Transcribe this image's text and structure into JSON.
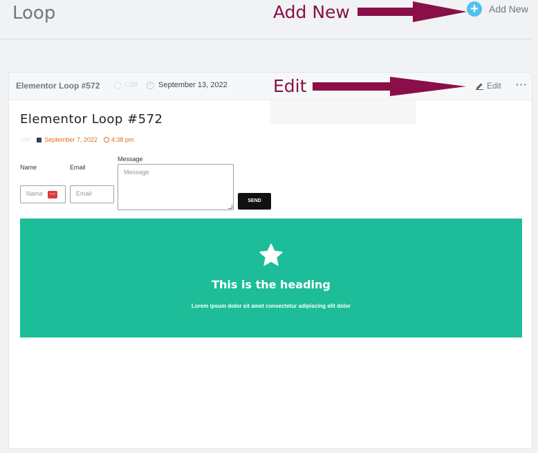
{
  "page": {
    "title": "Loop",
    "add_new_label": "Add New",
    "add_new_icon": "plus-circle-icon"
  },
  "annotations": {
    "add_new": "Add New",
    "edit": "Edit",
    "color": "#8a0f48"
  },
  "card": {
    "title": "Elementor Loop #572",
    "author": "Cliff",
    "date": "September 13, 2022",
    "edit_label": "Edit",
    "more_label": "···"
  },
  "preview": {
    "title": "Elementor Loop #572",
    "meta": {
      "author": "Cliff",
      "date": "September 7, 2022",
      "time": "4:38 pm"
    },
    "form": {
      "name_label": "Name",
      "email_label": "Email",
      "message_label": "Message",
      "name_placeholder": "Name",
      "email_placeholder": "Email",
      "message_placeholder": "Message",
      "send_label": "SEND"
    },
    "banner": {
      "heading": "This is the heading",
      "text": "Lorem ipsum dolor sit amet consectetur adipiscing elit dolor",
      "color": "#1dbd99",
      "icon": "star-icon"
    }
  }
}
